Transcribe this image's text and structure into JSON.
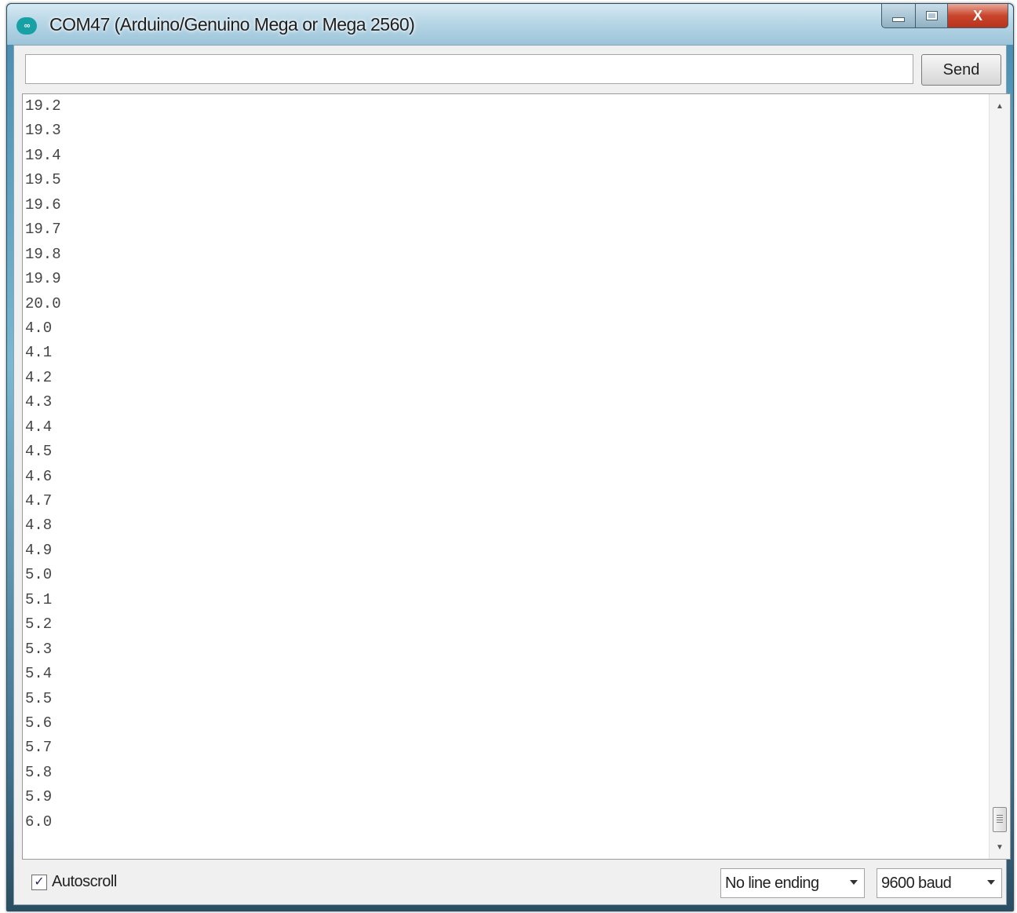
{
  "window": {
    "title": "COM47 (Arduino/Genuino Mega or Mega 2560)",
    "app_icon_text": "∞",
    "close_glyph": "X"
  },
  "send_bar": {
    "input_value": "",
    "send_label": "Send"
  },
  "output": {
    "lines": [
      "19.2",
      "19.3",
      "19.4",
      "19.5",
      "19.6",
      "19.7",
      "19.8",
      "19.9",
      "20.0",
      "4.0",
      "4.1",
      "4.2",
      "4.3",
      "4.4",
      "4.5",
      "4.6",
      "4.7",
      "4.8",
      "4.9",
      "5.0",
      "5.1",
      "5.2",
      "5.3",
      "5.4",
      "5.5",
      "5.6",
      "5.7",
      "5.8",
      "5.9",
      "6.0"
    ]
  },
  "footer": {
    "autoscroll_label": "Autoscroll",
    "autoscroll_checked": true,
    "check_glyph": "✓",
    "line_ending": "No line ending",
    "baud_rate": "9600 baud"
  },
  "icons": {
    "up": "▲",
    "down": "▼"
  }
}
